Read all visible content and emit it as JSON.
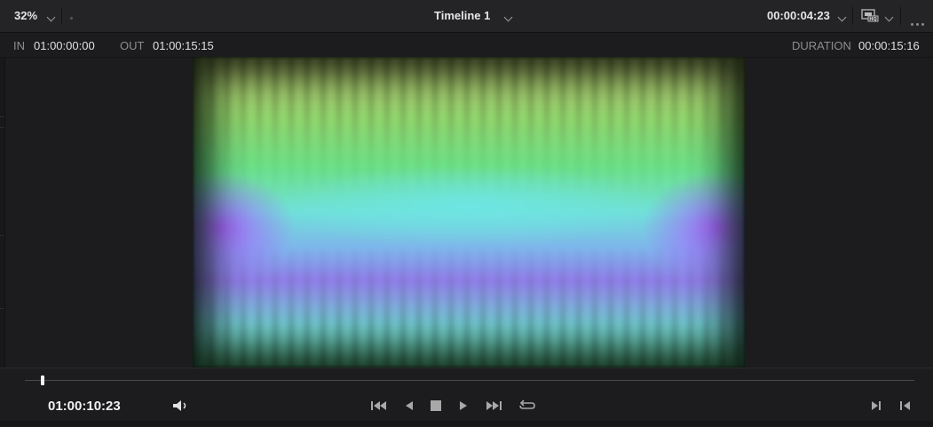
{
  "topbar": {
    "zoom": "32%",
    "timeline_title": "Timeline 1",
    "timecode": "00:00:04:23"
  },
  "inout": {
    "in_label": "IN",
    "in_value": "01:00:00:00",
    "out_label": "OUT",
    "out_value": "01:00:15:15",
    "duration_label": "DURATION",
    "duration_value": "00:00:15:16"
  },
  "transport": {
    "current_timecode": "01:00:10:23",
    "playhead_progress": 0.02,
    "buttons": [
      "jump-to-start",
      "play-reverse",
      "stop",
      "play",
      "jump-to-end",
      "loop"
    ],
    "right_buttons": [
      "next-clip",
      "previous-clip"
    ]
  },
  "colors": {
    "background": "#1c1c1e",
    "panel": "#242427",
    "text_primary": "#e6e6e6",
    "text_secondary": "#8d8d8d"
  }
}
